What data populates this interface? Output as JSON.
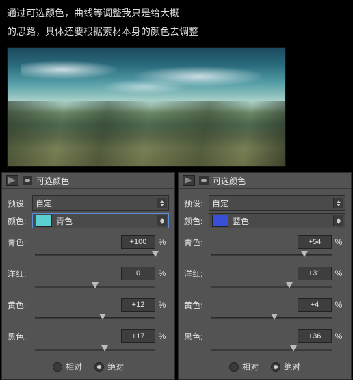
{
  "caption": {
    "line1": "通过可选颜色，曲线等调整我只是给大概",
    "line2": "的思路，具体还要根据素材本身的颜色去调整"
  },
  "panel_title": "可选颜色",
  "labels": {
    "preset": "预设:",
    "color": "颜色:",
    "cyan": "青色:",
    "magenta": "洋红:",
    "yellow": "黄色:",
    "black": "黑色:",
    "pct": "%",
    "relative": "相对",
    "absolute": "绝对"
  },
  "left": {
    "preset_value": "自定",
    "color_label": "青色",
    "swatch": "#5bd0d0",
    "sliders": {
      "cyan": {
        "value": "+100",
        "pos": 100
      },
      "magenta": {
        "value": "0",
        "pos": 50
      },
      "yellow": {
        "value": "+12",
        "pos": 56
      },
      "black": {
        "value": "+17",
        "pos": 58
      }
    },
    "mode_selected": "absolute"
  },
  "right": {
    "preset_value": "自定",
    "color_label": "蓝色",
    "swatch": "#3a4fd8",
    "sliders": {
      "cyan": {
        "value": "+54",
        "pos": 77
      },
      "magenta": {
        "value": "+31",
        "pos": 65
      },
      "yellow": {
        "value": "+4",
        "pos": 52
      },
      "black": {
        "value": "+36",
        "pos": 68
      }
    },
    "mode_selected": "absolute"
  }
}
